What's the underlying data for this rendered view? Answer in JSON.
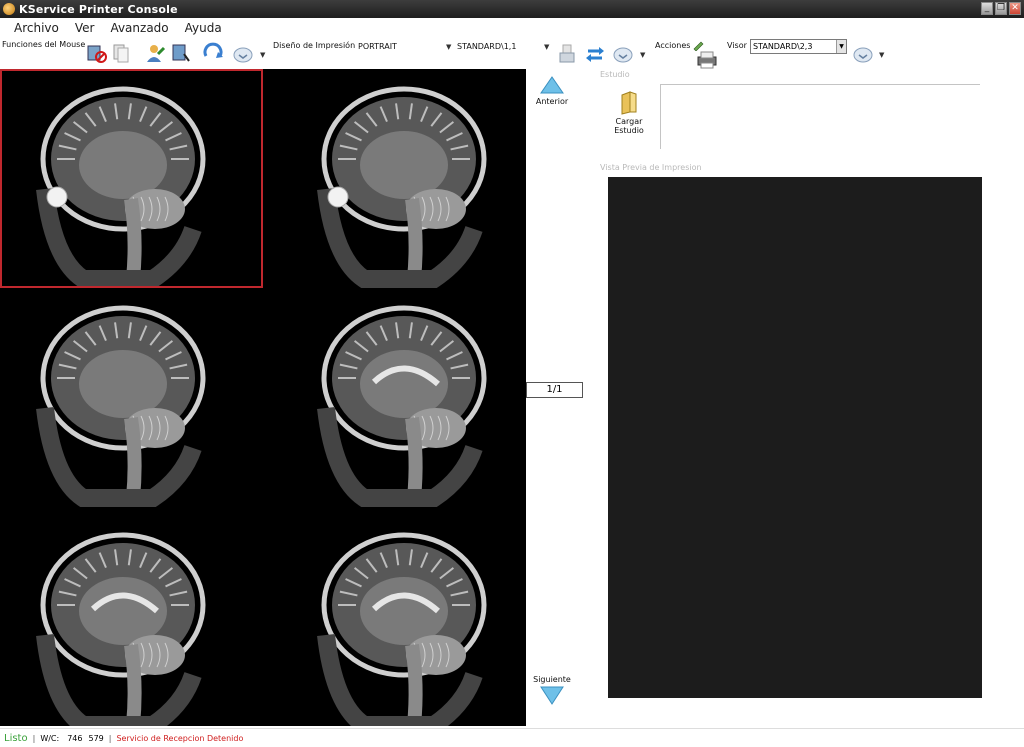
{
  "window": {
    "title": "KService Printer Console"
  },
  "menu": {
    "items": [
      "Archivo",
      "Ver",
      "Avanzado",
      "Ayuda"
    ]
  },
  "toolbar": {
    "mouse_functions_label": "Funciones del Mouse",
    "print_layout_label": "Diseño de Impresión",
    "orientation_value": "PORTRAIT",
    "format_value": "STANDARD\\1,1",
    "actions_label": "Acciones",
    "viewer_label": "Visor",
    "viewer_value": "STANDARD\\2,3"
  },
  "navigation": {
    "previous_label": "Anterior",
    "next_label": "Siguiente",
    "page": "1/1"
  },
  "right_panel": {
    "study_group_label": "Estudio",
    "load_study_label_line1": "Cargar",
    "load_study_label_line2": "Estudio",
    "preview_group_label": "Vista Previa de Impresion"
  },
  "status": {
    "ready": "Listo",
    "wc_label": "W/C:",
    "window_value": "746",
    "center_value": "579",
    "service_status": "Servicio de Recepcion Detenido"
  },
  "colors": {
    "selection_border": "#c0282e",
    "status_ready": "#3aa13a",
    "status_error": "#d02020",
    "arrow_blue": "#6ec0e8"
  },
  "viewer_grid": {
    "columns": 2,
    "rows": 3,
    "selected_index": 0
  }
}
